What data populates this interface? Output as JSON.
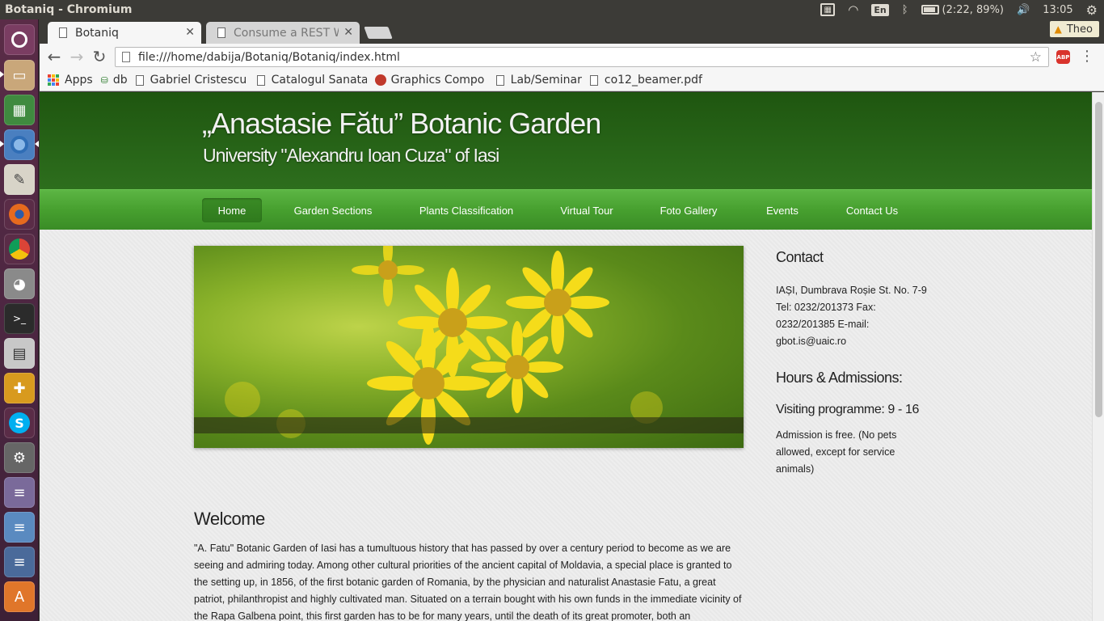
{
  "system": {
    "window_title": "Botaniq - Chromium",
    "keyboard_layout": "En",
    "battery": "(2:22, 89%)",
    "clock": "13:05"
  },
  "browser": {
    "tabs": [
      {
        "label": "Botaniq",
        "active": true
      },
      {
        "label": "Consume a REST W",
        "active": false
      }
    ],
    "profile_name": "Theo",
    "url": "file:///home/dabija/Botaniq/Botaniq/index.html",
    "adblock_label": "ABP",
    "bookmarks": [
      {
        "label": "Apps",
        "icon": "apps-grid-icon"
      },
      {
        "label": "db",
        "icon": "db-icon"
      },
      {
        "label": "Gabriel Cristescu",
        "icon": "page-icon"
      },
      {
        "label": "Catalogul Sanata",
        "icon": "page-icon"
      },
      {
        "label": "Graphics Compo",
        "icon": "tc-icon"
      },
      {
        "label": "Lab/Seminar",
        "icon": "page-icon"
      },
      {
        "label": "co12_beamer.pdf",
        "icon": "page-icon"
      }
    ]
  },
  "site": {
    "title": "„Anastasie Fătu” Botanic Garden",
    "subtitle": "University \"Alexandru Ioan Cuza\" of Iasi",
    "nav": [
      {
        "label": "Home",
        "active": true
      },
      {
        "label": "Garden Sections",
        "active": false
      },
      {
        "label": "Plants Classification",
        "active": false
      },
      {
        "label": "Virtual Tour",
        "active": false
      },
      {
        "label": "Foto Gallery",
        "active": false
      },
      {
        "label": "Events",
        "active": false
      },
      {
        "label": "Contact Us",
        "active": false
      }
    ],
    "welcome": {
      "heading": "Welcome",
      "text": "\"A. Fatu\" Botanic Garden of Iasi has a tumultuous history that has passed by over a century period to become as we are seeing and admiring today. Among other cultural priorities of the ancient capital of Moldavia, a special place is granted to the setting up, in 1856, of the first botanic garden of Romania, by the physician and naturalist Anastasie Fatu, a great patriot, philanthropist and highly cultivated man. Situated on a terrain bought with his own funds in the immediate vicinity of the Rapa Galbena point, this first garden has to be for many years, until the death of its great promoter, both an"
    },
    "sidebar": {
      "contact_heading": "Contact",
      "contact_text": "IAȘI, Dumbrava Roșie St. No. 7-9 Tel: 0232/201373 Fax: 0232/201385 E-mail: gbot.is@uaic.ro",
      "hours_heading": "Hours & Admissions:",
      "visiting": "Visiting programme: 9 - 16",
      "admission": "Admission is free. (No pets allowed, except for service animals)"
    },
    "colors": {
      "header_green": "#2d6e1d",
      "nav_green": "#47a02f"
    }
  }
}
